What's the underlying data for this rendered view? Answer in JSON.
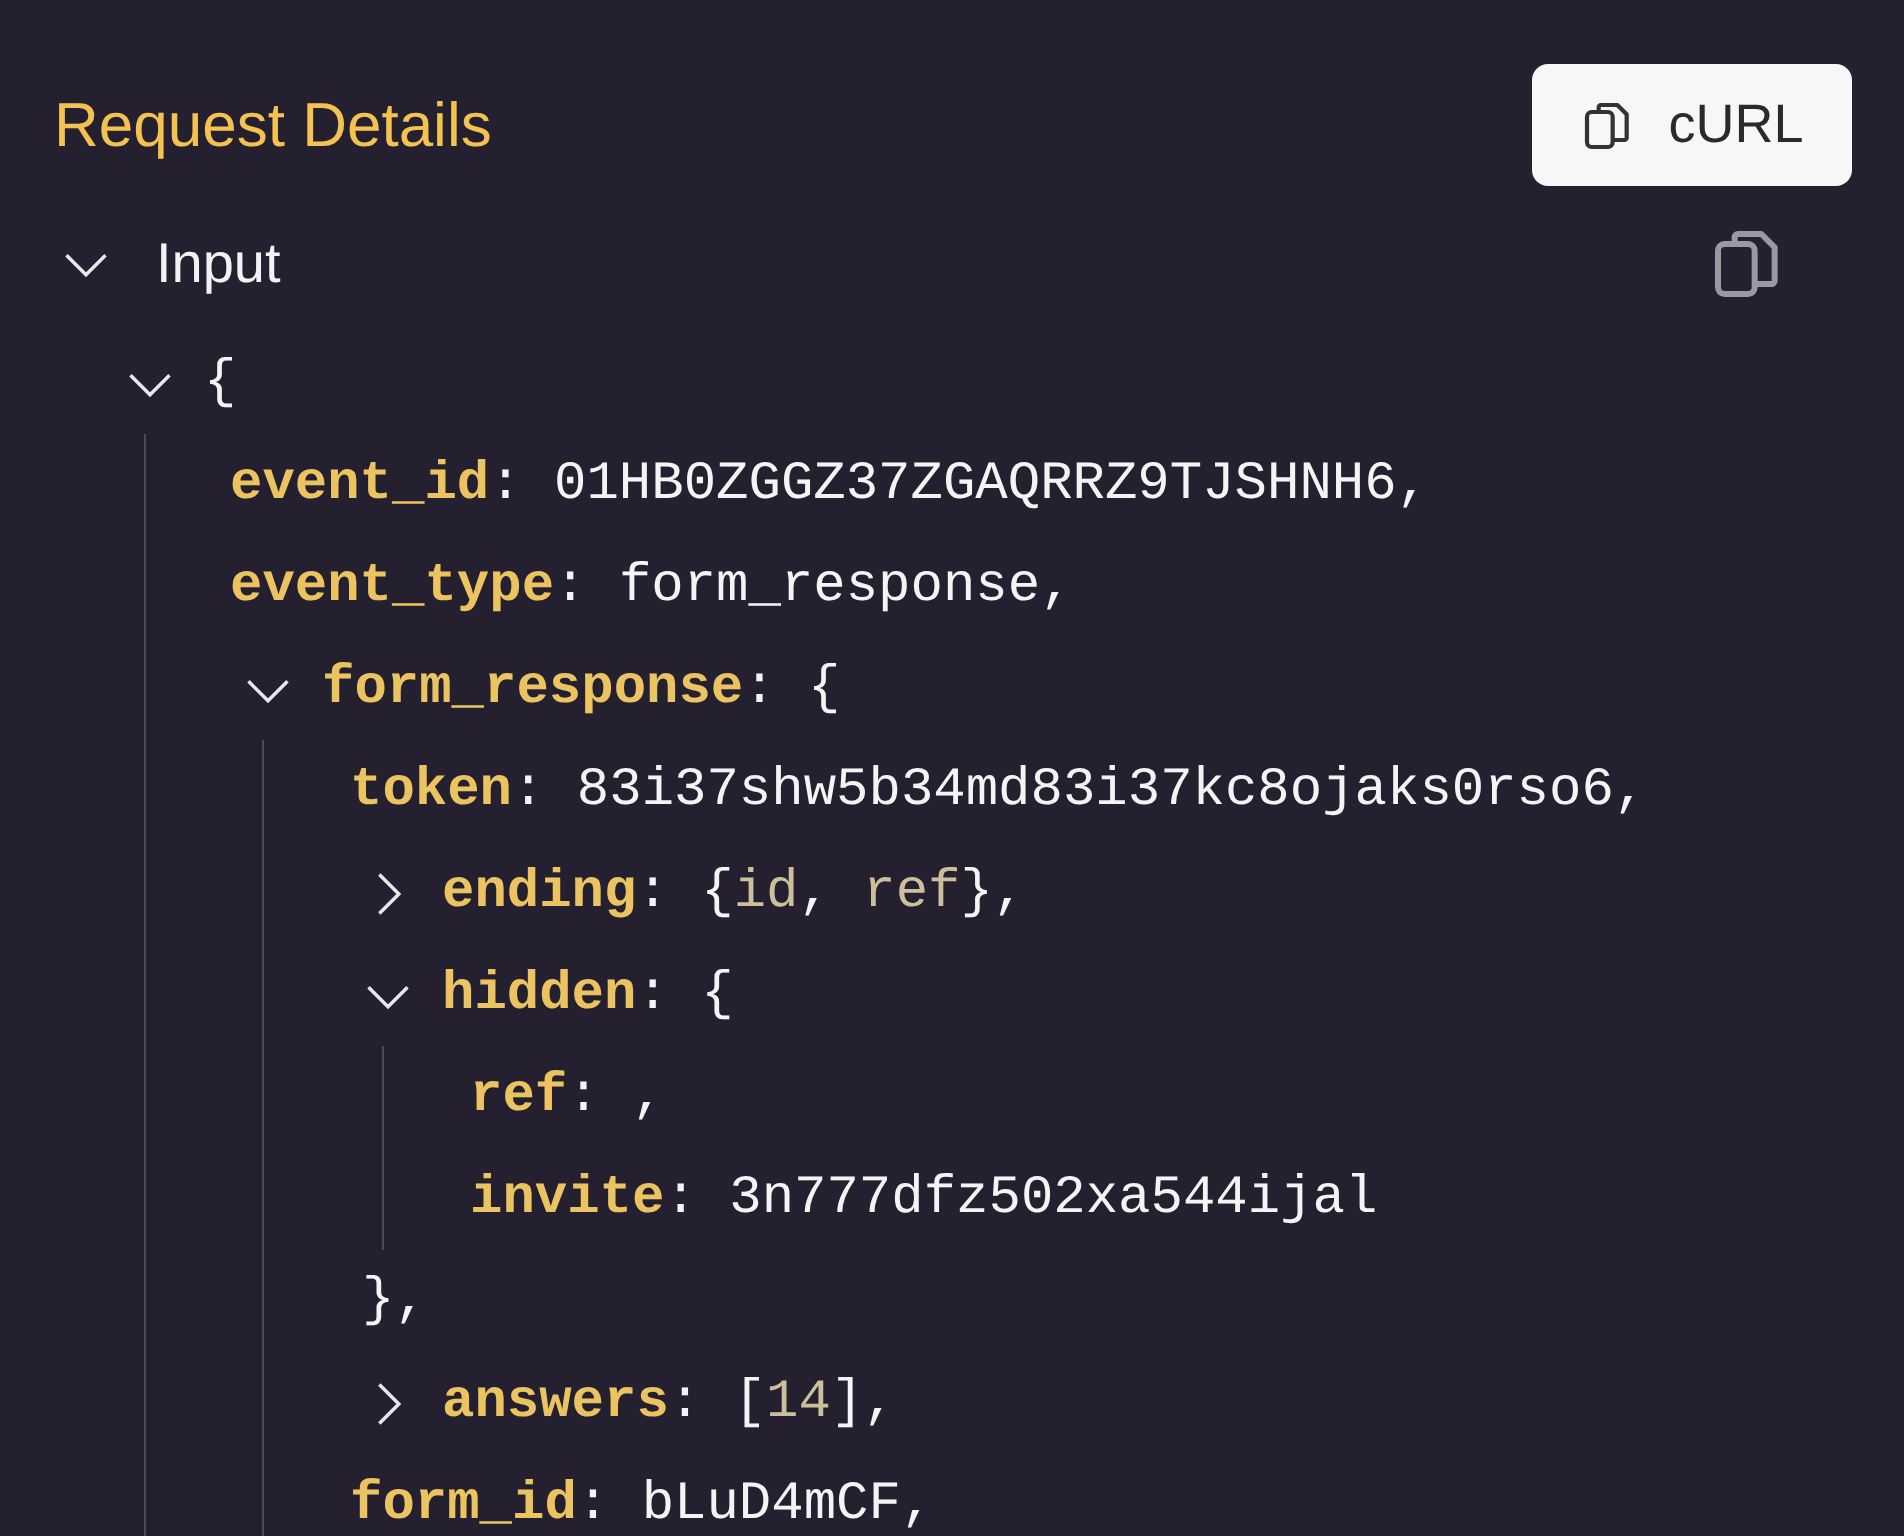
{
  "header": {
    "title": "Request Details",
    "curl_button": "cURL"
  },
  "section": {
    "label": "Input",
    "expanded": true,
    "tree": {
      "kind": "object",
      "open": "{",
      "expanded": true,
      "children": [
        {
          "kind": "field",
          "key": "event_id",
          "sep": ": ",
          "value": "01HB0ZGGZ37ZGAQRRZ9TJSHNH6,"
        },
        {
          "kind": "field",
          "key": "event_type",
          "sep": ": ",
          "value": "form_response,"
        },
        {
          "kind": "object",
          "key": "form_response",
          "sep": ": ",
          "open": "{",
          "expanded": true,
          "children": [
            {
              "kind": "field",
              "key": "token",
              "sep": ": ",
              "value": "83i37shw5b34md83i37kc8ojaks0rso6,"
            },
            {
              "kind": "object",
              "key": "ending",
              "sep": ": ",
              "expanded": false,
              "preview": [
                {
                  "text": "{",
                  "muted": false
                },
                {
                  "text": "id",
                  "muted": true
                },
                {
                  "text": ", ",
                  "muted": false
                },
                {
                  "text": "ref",
                  "muted": true
                },
                {
                  "text": "},",
                  "muted": false
                }
              ]
            },
            {
              "kind": "object",
              "key": "hidden",
              "sep": ": ",
              "open": "{",
              "expanded": true,
              "close": "},",
              "children": [
                {
                  "kind": "field",
                  "key": "ref",
                  "sep": ": ",
                  "value": ","
                },
                {
                  "kind": "field",
                  "key": "invite",
                  "sep": ": ",
                  "value": "3n777dfz502xa544ijal"
                }
              ]
            },
            {
              "kind": "object",
              "key": "answers",
              "sep": ": ",
              "expanded": false,
              "preview": [
                {
                  "text": "[",
                  "muted": false
                },
                {
                  "text": "14",
                  "muted": true
                },
                {
                  "text": "],",
                  "muted": false
                }
              ]
            },
            {
              "kind": "field",
              "key": "form_id",
              "sep": ": ",
              "value": "bLuD4mCF,"
            }
          ]
        }
      ]
    }
  }
}
